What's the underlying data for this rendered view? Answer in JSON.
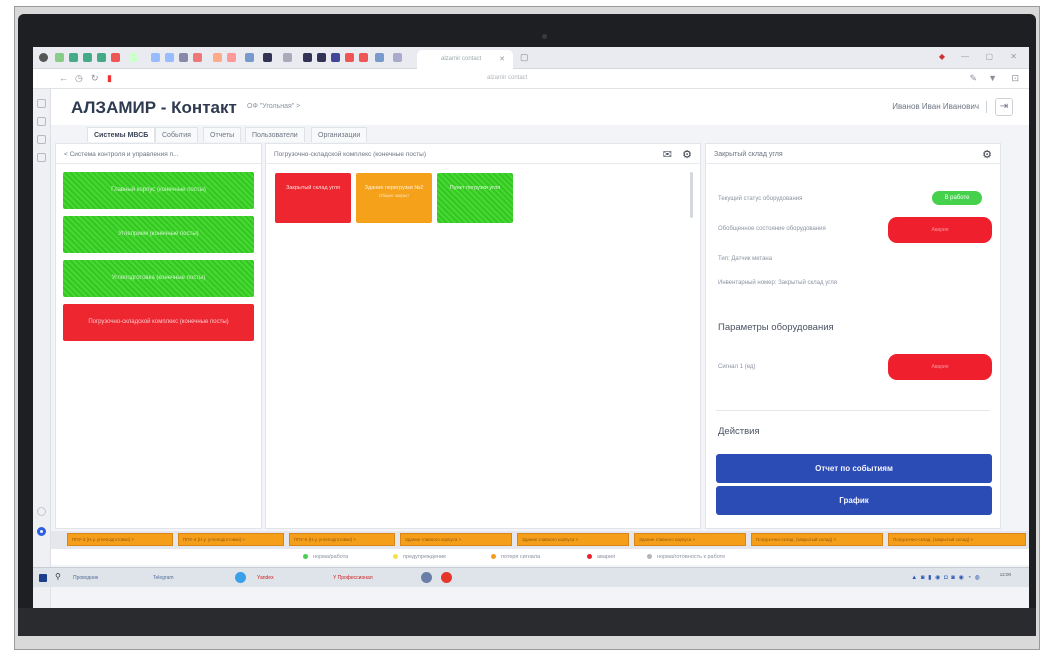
{
  "app": {
    "title": "АЛЗАМИР - Контакт",
    "org": "ОФ \"Угольная\" >",
    "user": "Иванов Иван Иванович",
    "logout_icon": "⇥"
  },
  "browser": {
    "tab_title": "alzamir contact",
    "url": "alzamir contact"
  },
  "nav_tabs": [
    {
      "label": "Системы МВСБ"
    },
    {
      "label": "События"
    },
    {
      "label": "Отчеты"
    },
    {
      "label": "Пользователи"
    },
    {
      "label": "Организации"
    }
  ],
  "left_panel": {
    "title": "< Система контроля и управления п...",
    "items": [
      {
        "label": "Главный корпус (конечные посты)",
        "status": "green"
      },
      {
        "label": "Углеприем (конечные посты)",
        "status": "green"
      },
      {
        "label": "Углеподготовка (конечные посты)",
        "status": "green"
      },
      {
        "label": "Погрузочно-складской комплекс (конечные посты)",
        "status": "red"
      }
    ]
  },
  "center_panel": {
    "title": "Погрузочно-складской комплекс (конечные посты)",
    "tiles": [
      {
        "label": "Закрытый склад угля",
        "sub": "",
        "status": "red"
      },
      {
        "label": "Здание перегрузки №2",
        "sub": "Общее закрыт",
        "status": "orange"
      },
      {
        "label": "Пункт погрузки угля",
        "sub": "",
        "status": "green"
      }
    ]
  },
  "right_panel": {
    "title": "Закрытый склад угля",
    "status_label": "Текущий статус оборудования",
    "status_value": "В работе",
    "state_label": "Обобщенное состояние оборудования",
    "state_value": "Авария",
    "type_label": "Тип: Датчик метана",
    "inventory_label": "Инвентарный номер: Закрытый склад угля",
    "params_title": "Параметры оборудования",
    "signal_label": "Сигнал 1 (ед)",
    "signal_value": "Авария",
    "actions_title": "Действия",
    "btn_report": "Отчет по событиям",
    "btn_chart": "График"
  },
  "ticker": [
    "ППУ-3 (Н.у. углеподготовки) >",
    "ППУ-4 (Н.у. углеподготовки) >",
    "ППУ-5 (Н.у. углеподготовки) >",
    "Здание главного корпуса >",
    "Здание главного корпуса >",
    "Здание главного корпуса >",
    "Погрузочно-склад. (закрытый склад) >",
    "Погрузочно-склад. (закрытый склад) >"
  ],
  "legend": [
    {
      "label": "норма/работа",
      "color": "#45d14b"
    },
    {
      "label": "предупреждение",
      "color": "#f3e24a"
    },
    {
      "label": "потеря сигнала",
      "color": "#f59e1a"
    },
    {
      "label": "авария",
      "color": "#ef1f2d"
    },
    {
      "label": "норма/готовность к работе",
      "color": "#b0b4bb"
    }
  ],
  "taskbar": {
    "items": [
      "Проводник",
      "Telegram",
      "Yandex",
      "Y Профессионал"
    ],
    "clock": "12:00"
  },
  "icons": {
    "gear": "gear-icon",
    "mail": "mail-icon",
    "logout": "logout-icon"
  }
}
